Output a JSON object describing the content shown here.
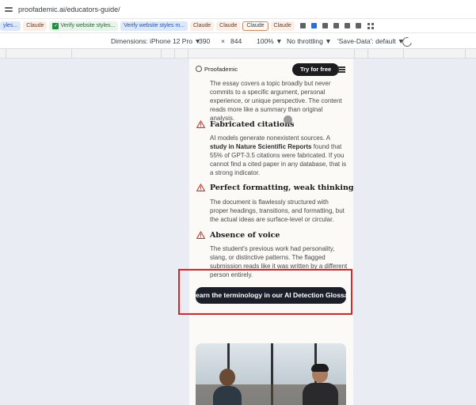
{
  "browser": {
    "url": "proofademic.ai/educators-guide/",
    "bookmarks": [
      {
        "label": "yles...",
        "style": "blue"
      },
      {
        "label": "Claude",
        "style": "peach"
      },
      {
        "label": "Verify website styles...",
        "style": "check"
      },
      {
        "label": "Verify website styles m...",
        "style": "blue"
      },
      {
        "label": "Claude",
        "style": "peach"
      },
      {
        "label": "Claude",
        "style": "peach"
      },
      {
        "label": "Claude",
        "style": "outlined"
      },
      {
        "label": "Claude",
        "style": "peach"
      }
    ]
  },
  "devtools": {
    "dimensions": "Dimensions: iPhone 12 Pro ▼",
    "width": "390",
    "times": "×",
    "height": "844",
    "zoom": "100% ▼",
    "throttle": "No throttling ▼",
    "save_data": "'Save-Data': default ▼"
  },
  "site": {
    "brand": "Proofademic",
    "cta": "Try for free",
    "intro": "The essay covers a topic broadly but never commits to a specific argument, personal experience, or unique perspective. The content reads more like a summary than original analysis.",
    "sections": [
      {
        "title": "Fabricated citations",
        "pre": "AI models generate nonexistent sources. A ",
        "bold": "study in Nature Scientific Reports",
        "post": " found that 55% of GPT-3.5 citations were fabricated. If you cannot find a cited paper in any database, that is a strong indicator."
      },
      {
        "title": "Perfect formatting, weak thinking",
        "body": "The document is flawlessly structured with proper headings, transitions, and formatting, but the actual ideas are surface-level or circular."
      },
      {
        "title": "Absence of voice",
        "body": "The student's previous work had personality, slang, or distinctive patterns. The flagged submission reads like it was written by a different person entirely."
      }
    ],
    "glossary_button": "earn the terminology in our AI Detection Glossar"
  },
  "colors": {
    "warning": "#d93025",
    "highlight": "#e02424",
    "button_dark": "#1b1f2a"
  }
}
